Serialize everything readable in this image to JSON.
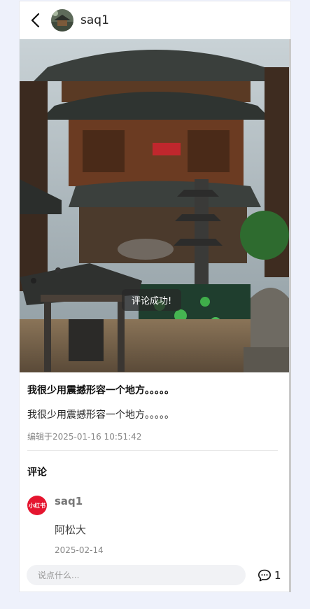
{
  "header": {
    "username": "saq1",
    "back_icon": "chevron-left-icon"
  },
  "toast": {
    "message": "评论成功!"
  },
  "post": {
    "title": "我很少用震撼形容一个地方。。。。。",
    "body": "我很少用震撼形容一个地方。。。。。",
    "edited": "编辑于2025-01-16 10:51:42"
  },
  "comments": {
    "title": "评论",
    "items": [
      {
        "avatar_text": "小红书",
        "username": "saq1",
        "text": "阿松大",
        "date": "2025-02-14"
      }
    ]
  },
  "footer": {
    "input_placeholder": "说点什么...",
    "comment_count": "1",
    "comment_icon": "chat-bubble-icon"
  },
  "colors": {
    "background": "#eef1fb",
    "avatar_red": "#e5152f"
  }
}
